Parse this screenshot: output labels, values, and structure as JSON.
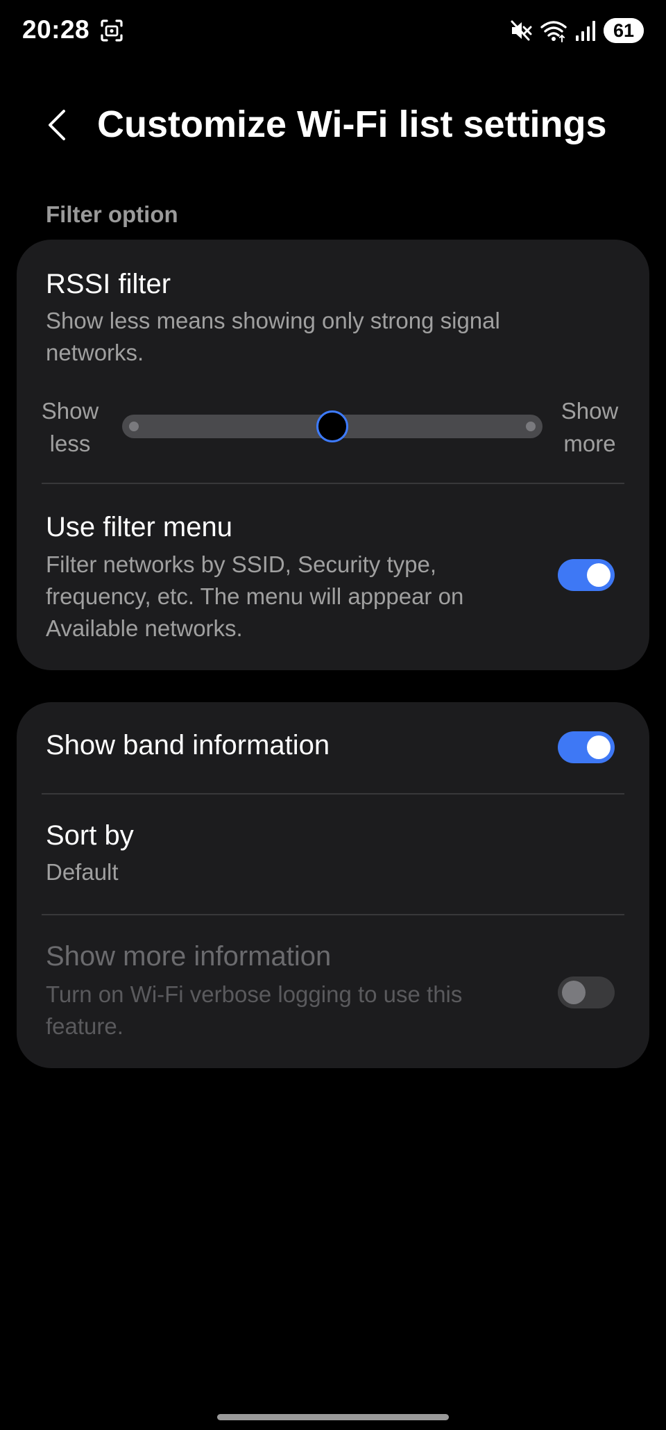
{
  "status_bar": {
    "time": "20:28",
    "battery_level": "61",
    "icons": [
      "screenshot-icon",
      "mute-icon",
      "wifi-icon",
      "signal-icon",
      "battery-icon"
    ]
  },
  "header": {
    "title": "Customize Wi-Fi list settings",
    "back_icon": "chevron-left-icon"
  },
  "filter_section": {
    "label": "Filter option",
    "rssi": {
      "title": "RSSI filter",
      "description": "Show less means showing only strong signal networks.",
      "min_label": "Show less",
      "max_label": "Show more",
      "level_fraction": 0.5
    },
    "filter_menu": {
      "title": "Use filter menu",
      "description": "Filter networks by SSID, Security type, frequency, etc. The menu will apppear on Available networks.",
      "enabled": true
    }
  },
  "display_section": {
    "band_info": {
      "title": "Show band information",
      "enabled": true
    },
    "sort_by": {
      "title": "Sort by",
      "value": "Default"
    },
    "more_info": {
      "title": "Show more information",
      "description": "Turn on Wi-Fi verbose logging to use this feature.",
      "enabled": false,
      "disabled": true
    }
  },
  "colors": {
    "accent": "#3e78f5",
    "card_background": "#1c1c1e",
    "background": "#000000"
  }
}
